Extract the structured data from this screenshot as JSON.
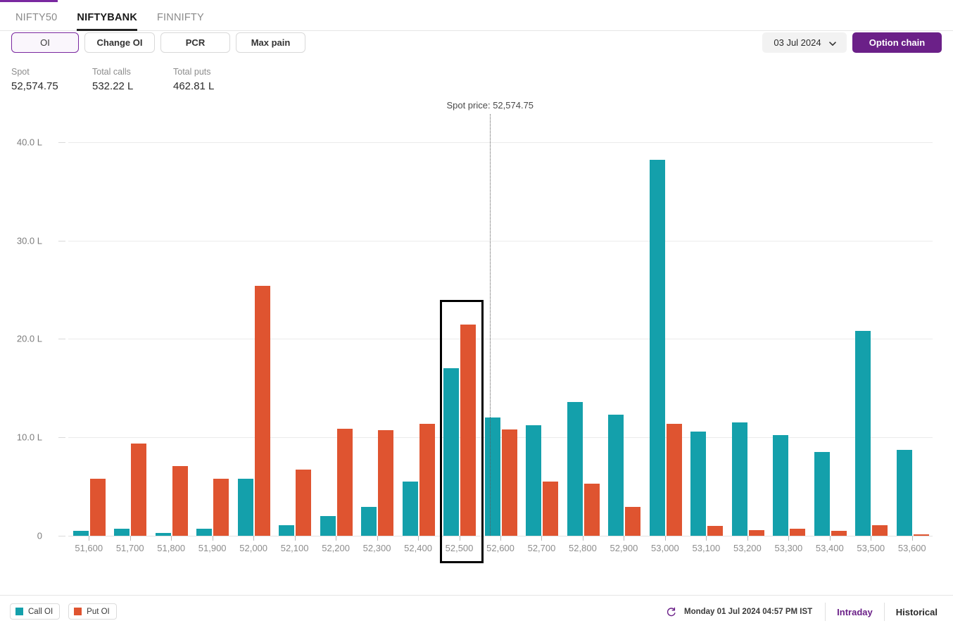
{
  "header": {
    "tabs": [
      {
        "label": "NIFTY50",
        "active": false
      },
      {
        "label": "NIFTYBANK",
        "active": true
      },
      {
        "label": "FINNIFTY",
        "active": false
      }
    ]
  },
  "toolbar": {
    "metric_buttons": [
      {
        "label": "OI",
        "active": true
      },
      {
        "label": "Change OI",
        "active": false
      },
      {
        "label": "PCR",
        "active": false
      },
      {
        "label": "Max pain",
        "active": false
      }
    ],
    "expiry_select": {
      "value": "03 Jul 2024",
      "icon": "chevron-down-icon"
    },
    "option_chain_label": "Option chain"
  },
  "stats": [
    {
      "label": "Spot",
      "value": "52,574.75"
    },
    {
      "label": "Total calls",
      "value": "532.22 L"
    },
    {
      "label": "Total puts",
      "value": "462.81 L"
    }
  ],
  "annotation": {
    "spot_price_label": "Spot price: 52,574.75"
  },
  "highlight": {
    "strike": "52,500"
  },
  "footer": {
    "legend": [
      {
        "label": "Call OI",
        "color": "#14a0ab",
        "name": "legend-call-oi"
      },
      {
        "label": "Put OI",
        "color": "#df5430",
        "name": "legend-put-oi"
      }
    ],
    "refresh_icon": "refresh-icon",
    "timestamp": "Monday 01 Jul 2024 04:57 PM IST",
    "modes": [
      {
        "label": "Intraday",
        "active": true
      },
      {
        "label": "Historical",
        "active": false
      }
    ]
  },
  "colors": {
    "call": "#14a0ab",
    "put": "#df5430",
    "accent": "#6b2088",
    "spot_line": "#5a5a5a",
    "highlight_border": "#000000"
  },
  "chart_data": {
    "type": "bar",
    "title": "",
    "xlabel": "",
    "ylabel": "",
    "unit": "L",
    "ylim": [
      0,
      42
    ],
    "yticks": [
      "0",
      "10.0 L",
      "20.0 L",
      "30.0 L",
      "40.0 L"
    ],
    "ytick_values": [
      0,
      10,
      20,
      30,
      40
    ],
    "grid": true,
    "legend_position": "bottom-left",
    "spot_price": 52574.75,
    "highlighted_category": "52,500",
    "categories": [
      "51,600",
      "51,700",
      "51,800",
      "51,900",
      "52,000",
      "52,100",
      "52,200",
      "52,300",
      "52,400",
      "52,500",
      "52,600",
      "52,700",
      "52,800",
      "52,900",
      "53,000",
      "53,100",
      "53,200",
      "53,300",
      "53,400",
      "53,500",
      "53,600"
    ],
    "series": [
      {
        "name": "Call OI",
        "color": "#14a0ab",
        "values": [
          0.5,
          0.7,
          0.3,
          0.7,
          5.8,
          1.1,
          2.0,
          2.9,
          5.5,
          17.0,
          12.0,
          11.2,
          13.6,
          12.3,
          38.2,
          10.6,
          11.5,
          10.2,
          8.5,
          20.8,
          8.7
        ]
      },
      {
        "name": "Put OI",
        "color": "#df5430",
        "values": [
          5.8,
          9.4,
          7.1,
          5.8,
          25.4,
          6.7,
          10.9,
          10.7,
          11.4,
          21.5,
          10.8,
          5.5,
          5.3,
          2.9,
          11.4,
          1.0,
          0.6,
          0.7,
          0.5,
          1.1,
          0.15
        ]
      }
    ]
  }
}
